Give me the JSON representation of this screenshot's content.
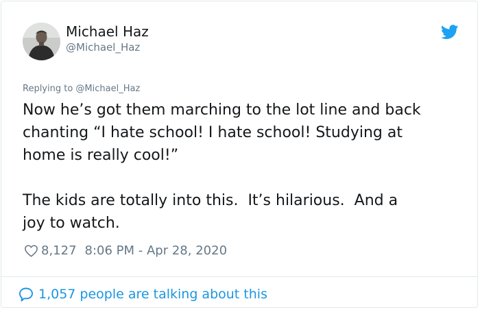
{
  "tweet": {
    "author": {
      "display_name": "Michael Haz",
      "handle": "@Michael_Haz",
      "avatar_icon": "avatar-photo"
    },
    "brand_icon": "twitter-bird-icon",
    "brand_color": "#1da1f2",
    "replying_to": "Replying to @Michael_Haz",
    "text": "Now he’s got them marching to the lot line and back\nchanting “I hate school! I hate school! Studying at\nhome is really cool!”\n\nThe kids are totally into this.  It’s hilarious.  And a\njoy to watch.",
    "likes": "8,127",
    "timestamp": "8:06 PM - Apr 28, 2020",
    "talking_about": "1,057 people are talking about this",
    "link_color": "#1b95e0",
    "muted_color": "#657786"
  }
}
